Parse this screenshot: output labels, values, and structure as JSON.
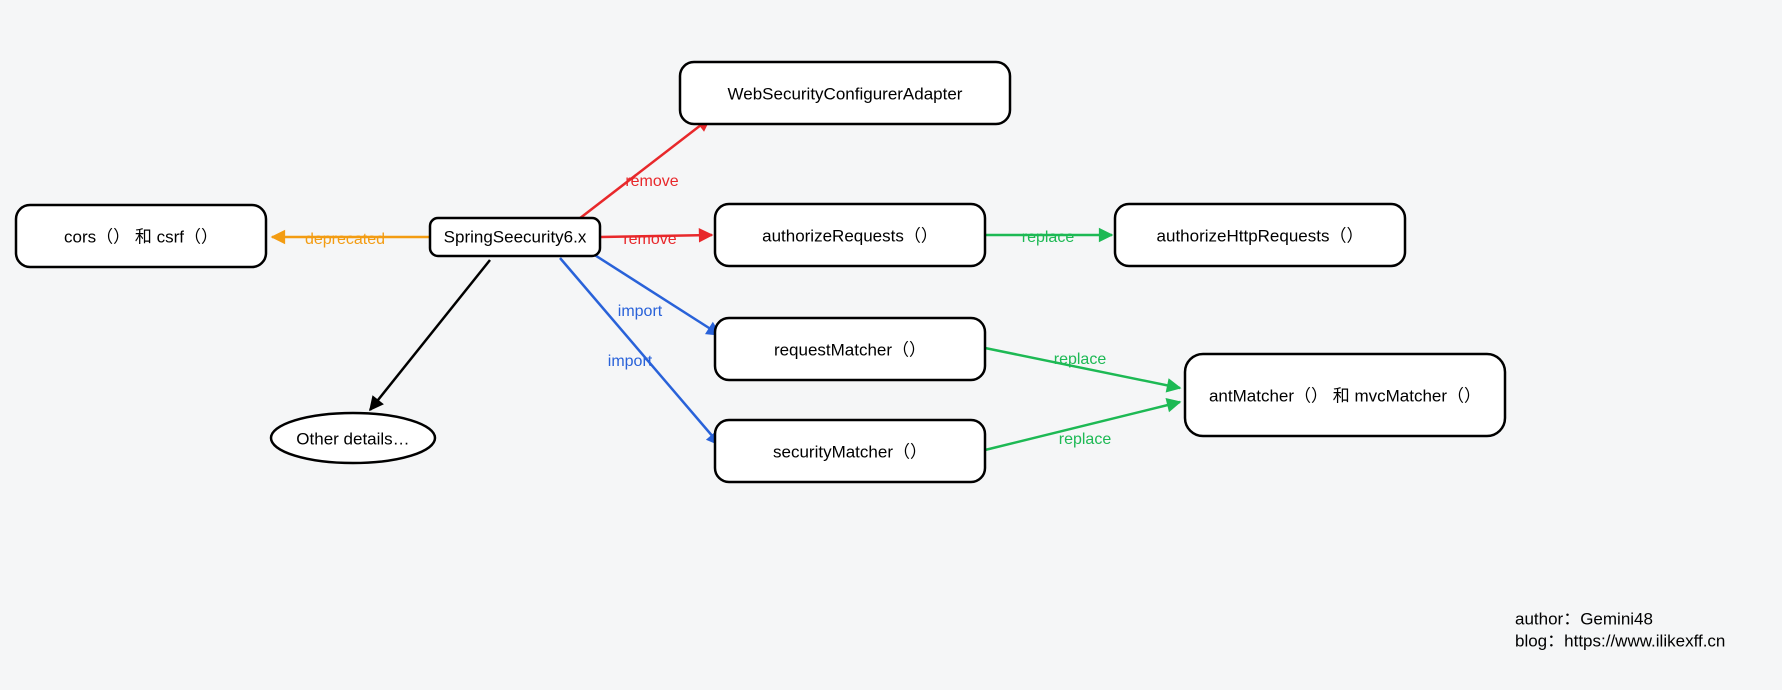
{
  "nodes": {
    "center": {
      "label": "SpringSeecurity6.x"
    },
    "cors": {
      "label": "cors（） 和 csrf（）"
    },
    "other": {
      "label": "Other details…"
    },
    "wsca": {
      "label": "WebSecurityConfigurerAdapter"
    },
    "authreq": {
      "label": "authorizeRequests（）"
    },
    "authhttp": {
      "label": "authorizeHttpRequests（）"
    },
    "reqmatch": {
      "label": "requestMatcher（）"
    },
    "secmatch": {
      "label": "securityMatcher（）"
    },
    "antmvc": {
      "label": "antMatcher（） 和 mvcMatcher（）"
    }
  },
  "edges": {
    "deprecated": {
      "label": "deprecated",
      "color": "#f39c12"
    },
    "remove1": {
      "label": "remove",
      "color": "#e8282b"
    },
    "remove2": {
      "label": "remove",
      "color": "#e8282b"
    },
    "import1": {
      "label": "import",
      "color": "#2962d9"
    },
    "import2": {
      "label": "import",
      "color": "#2962d9"
    },
    "replace1": {
      "label": "replace",
      "color": "#1db954"
    },
    "replace2": {
      "label": "replace",
      "color": "#1db954"
    },
    "replace3": {
      "label": "replace",
      "color": "#1db954"
    }
  },
  "credits": {
    "author": "author：Gemini48",
    "blog": "blog：https://www.ilikexff.cn"
  }
}
